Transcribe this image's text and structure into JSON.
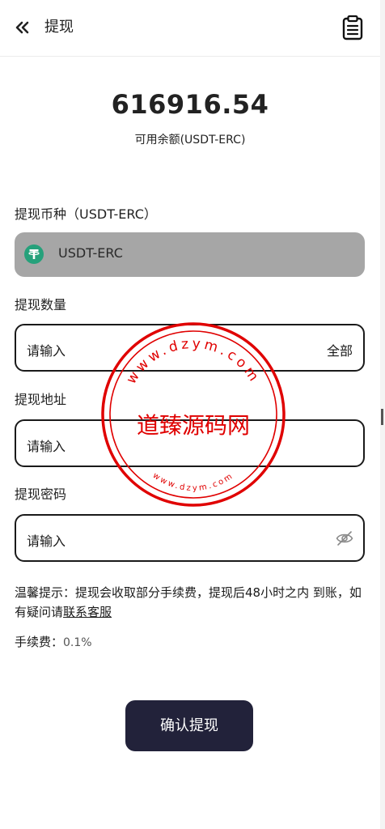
{
  "header": {
    "title": "提现",
    "back_icon": "double-chevron-left-icon",
    "record_icon": "clipboard-icon"
  },
  "balance": {
    "amount": "616916.54",
    "label": "可用余额(USDT-ERC)"
  },
  "currency": {
    "label": "提现币种（USDT-ERC）",
    "selected": "USDT-ERC",
    "icon": "tether-icon"
  },
  "quantity": {
    "label": "提现数量",
    "placeholder": "请输入",
    "all_label": "全部"
  },
  "address": {
    "label": "提现地址",
    "placeholder": "请输入"
  },
  "password": {
    "label": "提现密码",
    "placeholder": "请输入",
    "toggle_icon": "eye-off-icon"
  },
  "tip": {
    "text": "温馨提示：提现会收取部分手续费，提现后48小时之内 到账，如有疑问请",
    "link": "联系客服"
  },
  "fee": {
    "label": "手续费：",
    "value": "0.1%"
  },
  "submit_label": "确认提现",
  "watermark": {
    "center_text": "道臻源码网",
    "top_text": "www.dzym.com",
    "bottom_text": "www.dzym.com"
  },
  "colors": {
    "button_bg": "#22223a",
    "coin_box_bg": "#a6a6a6",
    "tether": "#26a17b",
    "watermark": "#e00000"
  }
}
